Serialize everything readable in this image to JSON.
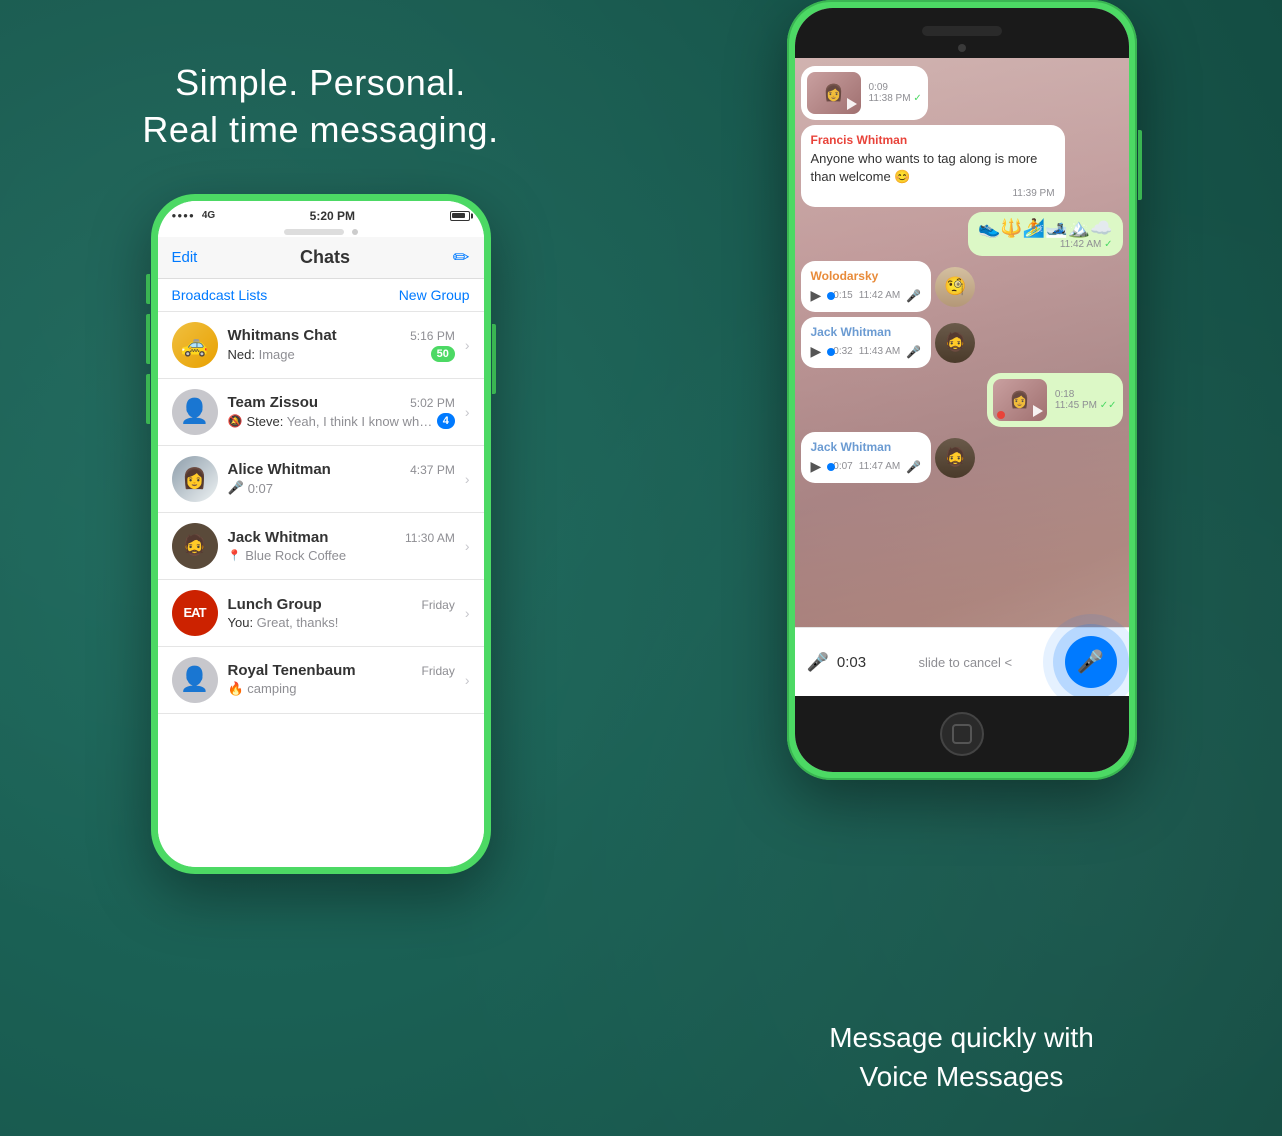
{
  "background": {
    "color": "#1a5c52"
  },
  "left": {
    "tagline": "Simple. Personal.\nReal time messaging.",
    "phone": {
      "status": {
        "dots": "●●●●",
        "network": "4G",
        "time": "5:20 PM",
        "battery_pct": 85
      },
      "nav": {
        "edit": "Edit",
        "title": "Chats",
        "compose": "✏"
      },
      "broadcast_bar": {
        "broadcast": "Broadcast Lists",
        "new_group": "New Group"
      },
      "chats": [
        {
          "id": "whitmans-chat",
          "name": "Whitmans Chat",
          "time": "5:16 PM",
          "preview_sender": "Ned:",
          "preview": "Image",
          "badge": "50",
          "avatar_type": "taxi",
          "badge_color": "green"
        },
        {
          "id": "team-zissou",
          "name": "Team Zissou",
          "time": "5:02 PM",
          "preview_sender": "Steve:",
          "preview": "Yeah, I think I know wha...",
          "badge": "4",
          "muted": true,
          "avatar_type": "person",
          "badge_color": "blue"
        },
        {
          "id": "alice-whitman",
          "name": "Alice Whitman",
          "time": "4:37 PM",
          "preview": "🎤 0:07",
          "avatar_type": "alice",
          "badge": null
        },
        {
          "id": "jack-whitman",
          "name": "Jack Whitman",
          "time": "11:30 AM",
          "preview_location": "📍",
          "preview": "Blue Rock Coffee",
          "avatar_type": "jack",
          "badge": null
        },
        {
          "id": "lunch-group",
          "name": "Lunch Group",
          "time": "Friday",
          "preview_sender": "You:",
          "preview": "Great, thanks!",
          "avatar_type": "eat",
          "badge": null
        },
        {
          "id": "royal-tenenbaum",
          "name": "Royal Tenenbaum",
          "time": "Friday",
          "preview": "camping",
          "preview_emoji": "🔥",
          "avatar_type": "person",
          "badge": null
        }
      ]
    }
  },
  "right": {
    "phone": {
      "messages": [
        {
          "type": "video-thumb",
          "time": "11:38 PM",
          "direction": "incoming",
          "duration": "0:09",
          "tick": "✓"
        },
        {
          "type": "text",
          "direction": "incoming",
          "sender": "Francis Whitman",
          "sender_color": "francis",
          "text": "Anyone who wants to tag along is more than welcome 😊",
          "time": "11:39 PM"
        },
        {
          "type": "emoji",
          "direction": "outgoing",
          "emojis": "👟🔱🏄🎿🏔️☁️",
          "time": "11:42 AM",
          "tick": "✓"
        },
        {
          "type": "voice",
          "direction": "incoming",
          "sender": "Wolodarsky",
          "sender_color": "wolodarsky",
          "duration": "0:15",
          "time": "11:42 AM",
          "has_avatar": true,
          "avatar_type": "man-glasses"
        },
        {
          "type": "voice",
          "direction": "incoming",
          "sender": "Jack Whitman",
          "sender_color": "jack",
          "duration": "0:32",
          "time": "11:43 AM",
          "has_avatar": true,
          "avatar_type": "man-mustache",
          "mic": true
        },
        {
          "type": "video-thumb-outgoing",
          "direction": "outgoing",
          "time": "11:45 PM",
          "tick": "✓✓"
        },
        {
          "type": "voice",
          "direction": "incoming",
          "sender": "Jack Whitman",
          "sender_color": "jack",
          "duration": "0:07",
          "time": "11:47 AM",
          "has_avatar": true,
          "avatar_type": "man-mustache",
          "mic": true
        }
      ],
      "recording": {
        "timer": "0:03",
        "slide_text": "slide to cancel <",
        "button_icon": "🎤"
      }
    },
    "bottom_text": "Message quickly with\nVoice Messages"
  }
}
